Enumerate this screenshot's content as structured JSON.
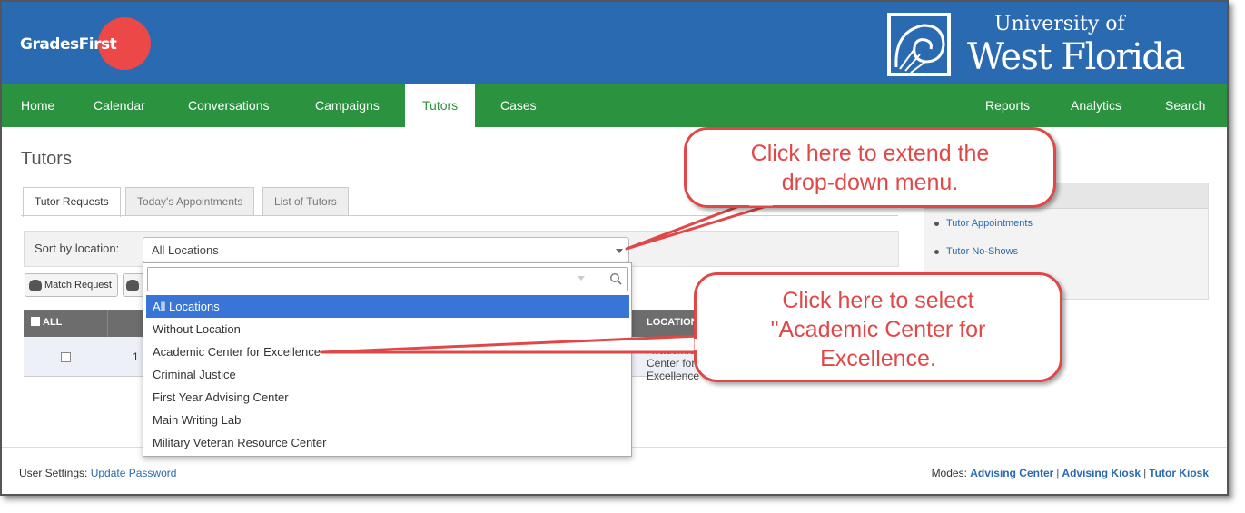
{
  "header": {
    "app_logo": {
      "part1": "Grades",
      "part2": "First"
    },
    "institution": {
      "line1": "University of",
      "line2": "West Florida"
    },
    "brand_colors": {
      "header_blue": "#2a6ab0",
      "nav_green": "#2b9340",
      "logo_red": "#ec4848"
    }
  },
  "nav": {
    "left": [
      "Home",
      "Calendar",
      "Conversations",
      "Campaigns",
      "Tutors",
      "Cases"
    ],
    "right": [
      "Reports",
      "Analytics",
      "Search"
    ],
    "active": "Tutors"
  },
  "page": {
    "title": "Tutors",
    "tabs": [
      "Tutor Requests",
      "Today's Appointments",
      "List of Tutors"
    ],
    "active_tab": "Tutor Requests",
    "sort_label": "Sort by location:",
    "sort_value": "All Locations",
    "buttons": {
      "match_request": "Match Request"
    },
    "table": {
      "col_all": "ALL",
      "col_location": "LOCATION",
      "row": {
        "number": "1",
        "location_line1": "Academic Center for",
        "location_line2": "Excellence"
      }
    }
  },
  "side_panel": {
    "links": [
      "Tutor Appointments",
      "Tutor No-Shows"
    ]
  },
  "dropdown": {
    "search_placeholder": "",
    "options": [
      "All Locations",
      "Without Location",
      "Academic Center for Excellence",
      "Criminal Justice",
      "First Year Advising Center",
      "Main Writing Lab",
      "Military Veteran Resource Center"
    ],
    "selected": "All Locations"
  },
  "callouts": {
    "c1": {
      "line1": "Click here to extend the",
      "line2": "drop-down menu."
    },
    "c2": {
      "line1": "Click here to select",
      "line2": "\"Academic Center for",
      "line3": "Excellence."
    },
    "color": "#e04848"
  },
  "footer": {
    "user_settings_label": "User Settings:",
    "update_password": "Update Password",
    "modes_label": "Modes:",
    "modes": [
      "Advising Center",
      "Advising Kiosk",
      "Tutor Kiosk"
    ],
    "separator": "|"
  }
}
